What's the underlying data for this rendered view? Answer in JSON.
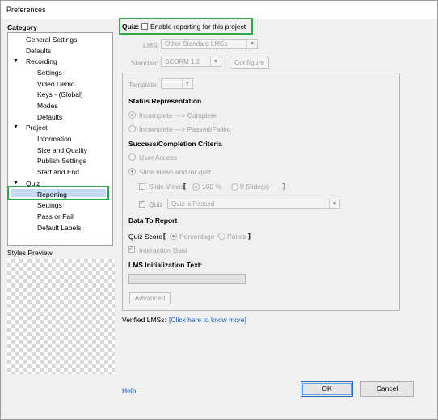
{
  "window": {
    "title": "Preferences"
  },
  "sidebar": {
    "heading": "Category",
    "items": [
      {
        "label": "General Settings"
      },
      {
        "label": "Defaults"
      },
      {
        "label": "Recording",
        "expander": "▼"
      },
      {
        "label": "Settings"
      },
      {
        "label": "Video Demo"
      },
      {
        "label": "Keys - (Global)"
      },
      {
        "label": "Modes"
      },
      {
        "label": "Defaults"
      },
      {
        "label": "Project",
        "expander": "▼"
      },
      {
        "label": "Information"
      },
      {
        "label": "Size and Quality"
      },
      {
        "label": "Publish Settings"
      },
      {
        "label": "Start and End"
      },
      {
        "label": "Quiz",
        "expander": "▼"
      },
      {
        "label": "Reporting",
        "selected": true
      },
      {
        "label": "Settings"
      },
      {
        "label": "Pass or Fail"
      },
      {
        "label": "Default Labels"
      }
    ],
    "styles_preview_label": "Styles Preview"
  },
  "quiz": {
    "label": "Quiz:",
    "enable_reporting_label": "Enable reporting for this project",
    "enable_reporting_checked": false
  },
  "lms": {
    "label": "LMS:",
    "value": "Other Standard LMSs"
  },
  "standard": {
    "label": "Standard:",
    "value": "SCORM 1.2",
    "configure_label": "Configure"
  },
  "template": {
    "label": "Template:",
    "value": ""
  },
  "status": {
    "heading": "Status Representation",
    "options": [
      {
        "label": "Incomplete ---> Complete",
        "selected": true
      },
      {
        "label": "Incomplete ---> Passed/Failed",
        "selected": false
      }
    ]
  },
  "success": {
    "heading": "Success/Completion Criteria",
    "user_access_label": "User Access",
    "slide_views_quiz_label": "Slide views and /or quiz",
    "slide_views_label": "Slide Views",
    "bracket_open": "[",
    "bracket_close": "]",
    "percent_label": "100 %",
    "slides_label": "0 Slide(s)",
    "quiz_label": "Quiz",
    "quiz_condition": "Quiz is Passed"
  },
  "data_report": {
    "heading": "Data To Report",
    "quiz_score_label": "Quiz Score",
    "bracket_open": "[",
    "bracket_close": "]",
    "percentage_label": "Percentage",
    "points_label": "Points",
    "interaction_data_label": "Interaction Data"
  },
  "lms_init": {
    "heading": "LMS Initialization Text:",
    "value": ""
  },
  "advanced_label": "Advanced",
  "verified": {
    "label": "Verified LMSs:",
    "link": "[Click here to know more]"
  },
  "help_label": "Help...",
  "ok_label": "OK",
  "cancel_label": "Cancel"
}
